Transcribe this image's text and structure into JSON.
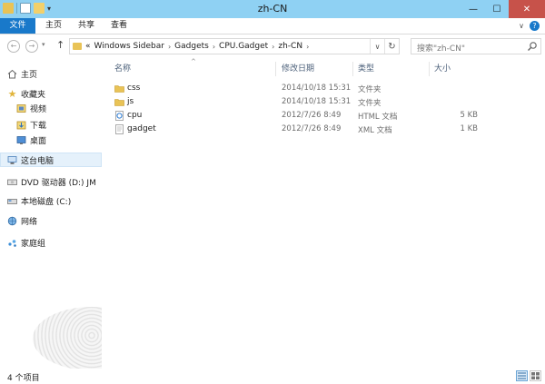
{
  "window": {
    "title": "zh-CN",
    "controls": {
      "minimize": "—",
      "maximize": "☐",
      "close": "✕"
    }
  },
  "ribbon": {
    "tabs": [
      "文件",
      "主页",
      "共享",
      "查看"
    ],
    "collapse_glyph": "∨",
    "help_glyph": "?"
  },
  "address": {
    "back_glyph": "←",
    "forward_glyph": "→",
    "recent_glyph": "▾",
    "up_glyph": "↑",
    "overflow": "«",
    "crumbs": [
      "Windows Sidebar",
      "Gadgets",
      "CPU.Gadget",
      "zh-CN"
    ],
    "separator": "›",
    "dropdown_glyph": "∨",
    "refresh_glyph": "↻"
  },
  "search": {
    "placeholder": "搜索\"zh-CN\""
  },
  "nav_pane": {
    "items": [
      {
        "label": "主页",
        "icon": "home-icon"
      },
      {
        "label": "收藏夹",
        "icon": "star-icon"
      },
      {
        "label": "视频",
        "icon": "video-icon"
      },
      {
        "label": "下载",
        "icon": "download-icon"
      },
      {
        "label": "桌面",
        "icon": "desktop-icon"
      },
      {
        "label": "这台电脑",
        "icon": "computer-icon"
      },
      {
        "label": "DVD 驱动器 (D:) JM",
        "icon": "dvd-icon"
      },
      {
        "label": "本地磁盘 (C:)",
        "icon": "drive-icon"
      },
      {
        "label": "网络",
        "icon": "network-icon"
      },
      {
        "label": "家庭组",
        "icon": "homegroup-icon"
      }
    ]
  },
  "columns": {
    "name": "名称",
    "date": "修改日期",
    "type": "类型",
    "size": "大小",
    "sort_glyph": "^"
  },
  "files": [
    {
      "name": "css",
      "date": "2014/10/18 15:31",
      "type": "文件夹",
      "size": "",
      "icon": "folder-icon"
    },
    {
      "name": "js",
      "date": "2014/10/18 15:31",
      "type": "文件夹",
      "size": "",
      "icon": "folder-icon"
    },
    {
      "name": "cpu",
      "date": "2012/7/26 8:49",
      "type": "HTML 文档",
      "size": "5 KB",
      "icon": "html-file-icon"
    },
    {
      "name": "gadget",
      "date": "2012/7/26 8:49",
      "type": "XML 文档",
      "size": "1 KB",
      "icon": "xml-file-icon"
    }
  ],
  "status": {
    "item_count": "4 个项目"
  },
  "colors": {
    "titlebar": "#8fd1f3",
    "file_tab": "#1979ca",
    "close": "#c7524a",
    "folder": "#e9c356",
    "selection": "#e5f1fb"
  }
}
